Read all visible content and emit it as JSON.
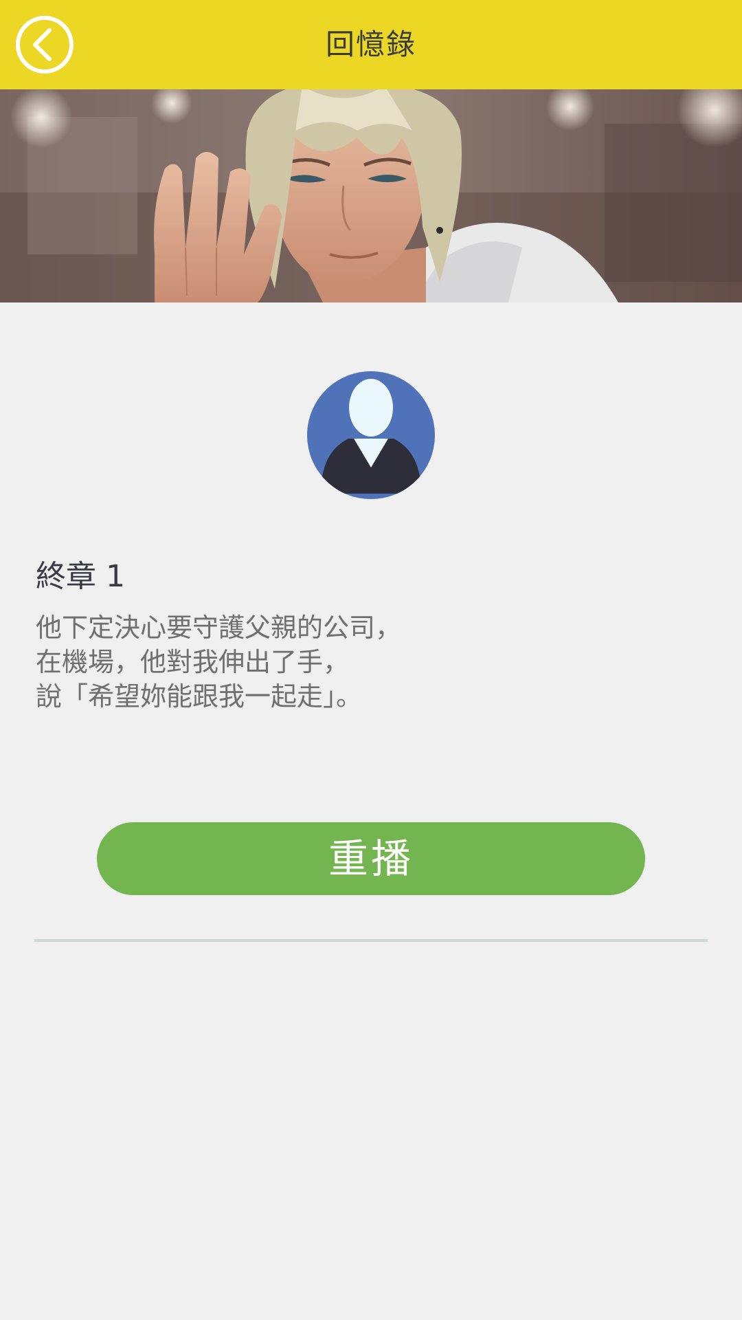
{
  "header": {
    "title": "回憶錄",
    "back_icon": "chevron-left-circle-icon",
    "background_color": "#ecd824"
  },
  "banner": {
    "image": "character-portrait-waving"
  },
  "avatar": {
    "icon": "default-user-avatar-icon",
    "background_color": "#4f72b8"
  },
  "chapter": {
    "title": "終章 1",
    "description_lines": [
      "他下定決心要守護父親的公司，",
      "在機場，他對我伸出了手，",
      "說「希望妳能跟我一起走」。"
    ]
  },
  "actions": {
    "replay_label": "重播",
    "replay_color": "#73b64f"
  }
}
